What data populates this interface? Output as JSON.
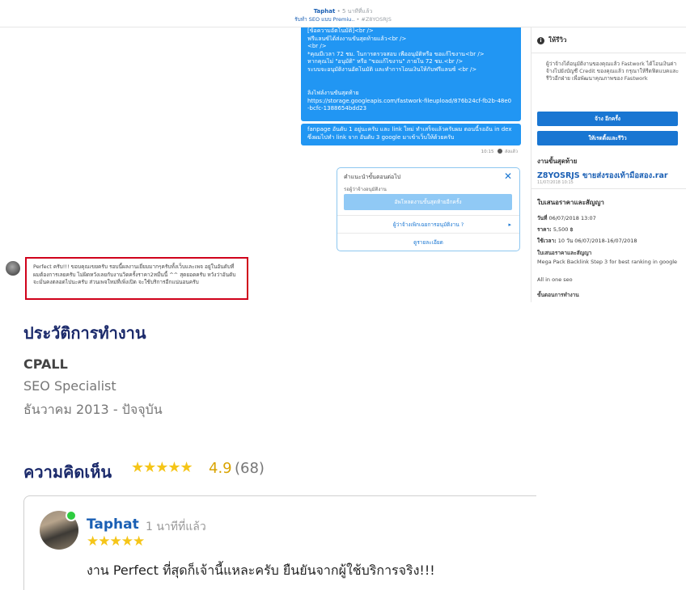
{
  "chat_header": {
    "name": "Taphat",
    "time": "• 5 นาทีที่แล้ว",
    "job": "รับทำ SEO แบบ Premiu..",
    "order": "• #Z8YOSRJS"
  },
  "messages": {
    "bubble_main_lines": [
      "[ข้อความอัตโนมัติ]<br />",
      "ฟรีแลนซ์ได้ส่งงานขั้นสุดท้ายแล้ว<br />",
      "<br />",
      "*คุณมีเวลา 72 ชม. ในการตรวจสอบ เพื่ออนุมัติหรือ ขอแก้ไขงาน<br />",
      "หากคุณไม่ \"อนุมัติ\" หรือ \"ขอแก้ไขงาน\" ภายใน 72 ชม.<br />",
      "ระบบจะอนุมัติงานอัตโนมัติ และทำการโอนเงินให้กับฟรีแลนซ์ <br />",
      "ลิ้งไฟล์งานขั้นสุดท้าย",
      "https://storage.googleapis.com/fastwork-fileupload/876b24cf-fb2b-48e0",
      "-bcfc-1388654bdd23"
    ],
    "bubble_2": "fanpage อันดับ 1 อยู่นะครับ และ link ใหม่ ทำเสร็จแล้วครับผม ตอนนี้รออัน in dex ซึ่งผมไปทำ link จาก อันดับ 3 google มาเข้าเว็บให้ด้วยครับ",
    "sent_time": "10:15",
    "sent_status": "ส่งแล้ว"
  },
  "suggestion": {
    "title": "คำแนะนำขั้นตอนต่อไป",
    "subtitle": "รอผู้ว่าจ้างอนุมัติงาน",
    "upload_btn": "อัพโหลดงานขั้นสุดท้ายอีกครั้ง",
    "option_1": "ผู้ว่าจ้างเพิกเฉยการอนุมัติงาน ?",
    "option_2": "ดูรายละเอียด"
  },
  "review_message": "Perfect ครับ!!! ขอบคุณเขยครับ รอบนี้ผลงานเยี่ยมมากๆครับทั้งเว็บและเพจ อยู่ในอันดับที่ผมต้องการเลยครับ ไม่ผิดหวังเลยกับงานวิดครั้งราคา2หมื่นนี้ ^^ สุดยอดครับ หวังว่าอันดับจะมั่นคงตลอดไปนะครับ ส่วนเพจใหม่ที่เพิ่งเปิด จะใช้บริการอีกแน่นอนครับ",
  "sidebar": {
    "review_title": "ให้รีวิว",
    "review_desc": "ผู้ว่าจ้างได้อนุมัติงานของคุณแล้ว Fastwork ได้โอนเงินค่าจ้างไปยังบัญชี Credit ของคุณแล้ว กรุณาให้รีดฟิดแบคและรีวิวอีกฝ่าย เพื่อพัฒนาคุณภาพของ Fastwork",
    "hire_again_btn": "จ้าง อีกครั้ง",
    "give_review_btn": "ให้เรตติ้งและรีวิว",
    "last_work_title": "งานขั้นสุดท้าย",
    "file_name": "Z8YOSRJS ขายส่งรองเท้ามือสอง.rar",
    "file_date": "11/07/2018 10:15",
    "quote_title": "ใบเสนอราคาและสัญญา",
    "date_label": "วันที่",
    "date_value": "06/07/2018 13:07",
    "price_label": "ราคา:",
    "price_value": "5,500 ฿",
    "duration_label": "ใช้เวลา:",
    "duration_value": "10 วัน 06/07/2018-16/07/2018",
    "contract_title": "ใบเสนอราคาและสัญญา",
    "contract_desc": "Mega Pack Backlink Step 3 for best ranking in google",
    "contract_desc2": "All in one seo",
    "steps_title": "ขั้นตอนการทำงาน"
  },
  "profile": {
    "work_title": "ประวัติการทำงาน",
    "company": "CPALL",
    "position": "SEO Specialist",
    "period": "ธันวาคม 2013 - ปัจจุบัน"
  },
  "opinions": {
    "title": "ความคิดเห็น",
    "stars": "★★★★★",
    "score": "4.9",
    "count": "(68)"
  },
  "review_card": {
    "name": "Taphat",
    "time": "1 นาทีที่แล้ว",
    "stars": "★★★★★",
    "text": "งาน Perfect ที่สุดก็เจ้านี้แหละครับ ยืนยันจากผู้ใช้บริการจริง!!!"
  },
  "colors": {
    "primary_blue": "#1976d2",
    "bubble_blue": "#2196f3",
    "heading_navy": "#1b2a6b",
    "star_gold": "#f5c518",
    "highlight_red": "#d0021b",
    "online_green": "#2ecc40"
  }
}
